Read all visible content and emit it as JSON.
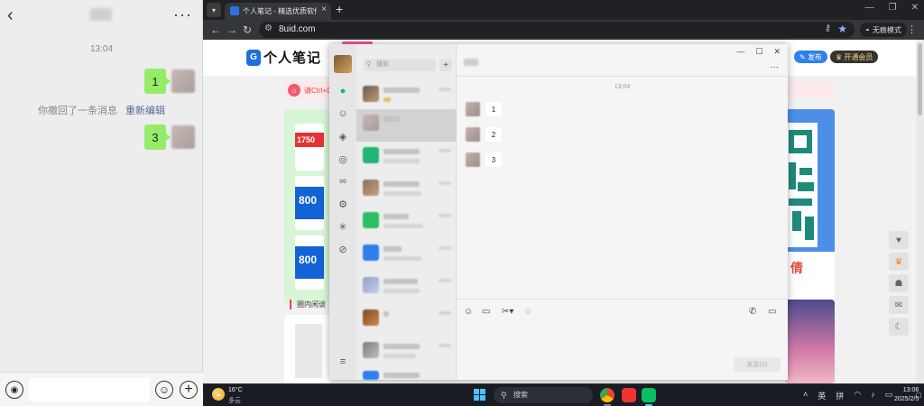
{
  "mobile": {
    "time": "13:04",
    "messages": [
      "1",
      "3"
    ],
    "recall_text": "你撤回了一条消息",
    "recall_link": "重新编辑",
    "icons": {
      "back": "chevron-left-icon",
      "more": "more-icon",
      "voice": "voice-icon",
      "emoji": "emoji-icon",
      "plus": "plus-icon"
    }
  },
  "browser": {
    "tab_title": "个人笔记 - 精选优质软件下载",
    "url": "8uid.com",
    "incognito_label": "无痕模式"
  },
  "site": {
    "logo_text": "个人笔记",
    "publish_label": "发布",
    "vip_label": "开通会员",
    "notice_text": "请Ctrl+D",
    "ad_price": "1750",
    "ad_num_a": "800",
    "ad_num_b": "800",
    "ad_right_char": "倩",
    "section_title": "圈内闲谈"
  },
  "wechat": {
    "search_placeholder": "搜索",
    "chat_time": "13:04",
    "messages": [
      "1",
      "2",
      "3"
    ],
    "send_label": "发送(S)"
  },
  "taskbar": {
    "weather_temp": "16°C",
    "weather_desc": "多云",
    "search_label": "搜索",
    "ime_lang": "英",
    "ime_mode": "拼",
    "clock_time": "13:06",
    "clock_date": "2025/2/5"
  },
  "colors": {
    "wechat_green": "#07c160",
    "bubble_green": "#95ec69",
    "link_blue": "#576b95"
  }
}
